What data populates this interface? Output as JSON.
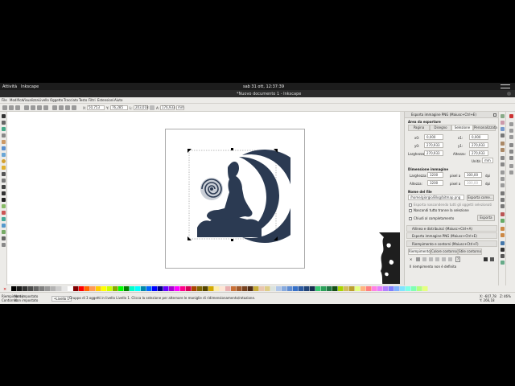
{
  "topbar": {
    "activities": "Attività",
    "app_menu": "Inkscape",
    "clock": "sab 31 ott, 12:37:39"
  },
  "window": {
    "title": "*Nuovo documento 1 - Inkscape"
  },
  "menu": [
    "File",
    "Modifica",
    "Visualizza",
    "Livello",
    "Oggetto",
    "Tracciato",
    "Testo",
    "Filtri",
    "Estensioni",
    "Aiuto"
  ],
  "toolctrl": {
    "x_label": "X:",
    "x_value": "50,753",
    "y_label": "Y:",
    "y_value": "76,285",
    "w_label": "L:",
    "w_value": "203,018",
    "h_label": "A:",
    "h_value": "176,933",
    "unit": "mm"
  },
  "export_dialog": {
    "title": "Esporta immagine PNG (Maiusc+Ctrl+E)",
    "area_heading": "Area da esportare",
    "tabs": [
      "Pagina",
      "Disegno",
      "Selezione",
      "Personalizzata"
    ],
    "x0_label": "x0:",
    "x0_value": "0,000",
    "x1_label": "x1:",
    "x1_value": "0,000",
    "y0_label": "y0:",
    "y0_value": "270,933",
    "y1_label": "y1:",
    "y1_value": "270,933",
    "width_label": "Larghezza:",
    "width_value": "270,933",
    "height_label": "Altezza:",
    "height_value": "270,933",
    "units_label": "Unità:",
    "units_value": "mm",
    "size_heading": "Dimensione immagine",
    "img_width_label": "Larghezza:",
    "img_width_value": "3200",
    "img_height_label": "Altezza:",
    "img_height_value": "3200",
    "px_at": "pixel a",
    "dpi_value": "300,00",
    "dpi_value2": "300,00",
    "dpi": "dpi",
    "filename_heading": "Nome del file",
    "filename_value": "/home/giorgio/Blog/bitmap.png",
    "export_as_button": "Esporta come...",
    "hide_all_except": "Esporta nascondendo tutti gli oggetti selezionati",
    "close_when_done": "Nascondi tutto tranne la selezione",
    "close_label": "Chiudi al completamento",
    "export_button": "Esporta"
  },
  "align_section": "Allinea e distribuisci (Maiusc+Ctrl+A)",
  "export_section2": "Esporta immagine PNG (Maiusc+Ctrl+E)",
  "fill_dialog": {
    "title": "Riempimento e contorni (Maiusc+Ctrl+F)",
    "tabs": [
      "Riempimento",
      "Colore contorno",
      "Stile contorno"
    ],
    "note": "Il riempimento non è definito"
  },
  "statusbar": {
    "fill_label": "Riempimento:",
    "fill_value": "Non impostato",
    "stroke_label": "Contorno:",
    "stroke_value": "Non impostato",
    "layer": "•Livello 1",
    "message": "Gruppo di 3 oggetti in livello Livello 1. Clicca la selezione per alternare le maniglie di ridimensionamento/rotazione.",
    "x_coord": "X: -607,78",
    "y_coord": "Y: 266,18",
    "zoom_label": "Z:",
    "zoom_value": "46%"
  },
  "colors": {
    "artwork": "#2b3a52",
    "topbar": "#1c1c1c",
    "chrome": "#ecebe8"
  },
  "palette_swatches": [
    "#000000",
    "#1a1a1a",
    "#333333",
    "#4d4d4d",
    "#666666",
    "#808080",
    "#999999",
    "#b3b3b3",
    "#cccccc",
    "#e6e6e6",
    "#ffffff",
    "#800000",
    "#ff0000",
    "#ff6600",
    "#ff9955",
    "#ffcc00",
    "#ffff00",
    "#ccff00",
    "#88aa00",
    "#00ff00",
    "#008000",
    "#00ffcc",
    "#00ffff",
    "#0088aa",
    "#0066ff",
    "#0000ff",
    "#000080",
    "#6600ff",
    "#aa00d4",
    "#ff00ff",
    "#ff0088",
    "#d40055",
    "#aa4400",
    "#806600",
    "#554400",
    "#d4aa00",
    "#ffeeaa",
    "#ffe6d5",
    "#e9afaf",
    "#c87137",
    "#a05a2c",
    "#784421",
    "#502d16",
    "#c8ab37",
    "#e9c6af",
    "#decd87",
    "#dbe3de",
    "#afc6e9",
    "#87aade",
    "#5f8dd3",
    "#3771c8",
    "#2c5aa0",
    "#214478",
    "#162d50",
    "#37c871",
    "#2ca05a",
    "#217844",
    "#165016",
    "#aad400",
    "#d3bc5f",
    "#bc9f2d",
    "#e5ff80",
    "#ffb380",
    "#ff8080",
    "#ff80e5",
    "#e580ff",
    "#b380ff",
    "#8080ff",
    "#80b3ff",
    "#80e5ff",
    "#80ffe6",
    "#80ffb3",
    "#b3ff80",
    "#e6ff80"
  ]
}
